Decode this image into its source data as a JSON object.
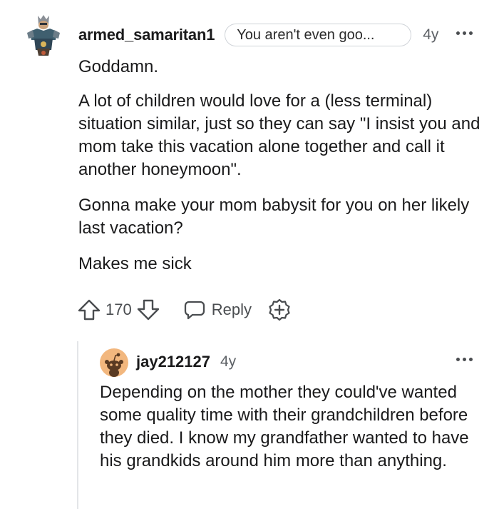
{
  "comment": {
    "username": "armed_samaritan1",
    "flair": "You aren't even goo...",
    "timestamp": "4y",
    "paragraphs": [
      "Goddamn.",
      "A lot of children would love for a (less terminal) situation similar, just so they can say \"I insist you and mom take this vacation alone together and call it another honeymoon\".",
      "Gonna make your mom babysit for you on her likely last vacation?",
      "Makes me sick"
    ],
    "actions": {
      "vote_count": "170",
      "reply_label": "Reply"
    },
    "icons": {
      "avatar": "user-avatar-icon",
      "upvote": "upvote-arrow-icon",
      "downvote": "downvote-arrow-icon",
      "reply": "speech-bubble-icon",
      "award": "add-award-icon",
      "more": "more-options-icon"
    }
  },
  "reply": {
    "username": "jay212127",
    "timestamp": "4y",
    "body": "Depending on the mother they could've wanted some quality time with their grandchildren before they died. I know my grandfather wanted to have his grandkids around him more than anything.",
    "icons": {
      "avatar": "default-snoo-avatar-icon",
      "more": "more-options-icon"
    }
  },
  "colors": {
    "text": "#1a1a1b",
    "meta": "#5d6166",
    "flair_border": "#cfd3d8",
    "thread_line": "#e3e5e8",
    "reply_avatar_bg": "#f2b77e"
  }
}
